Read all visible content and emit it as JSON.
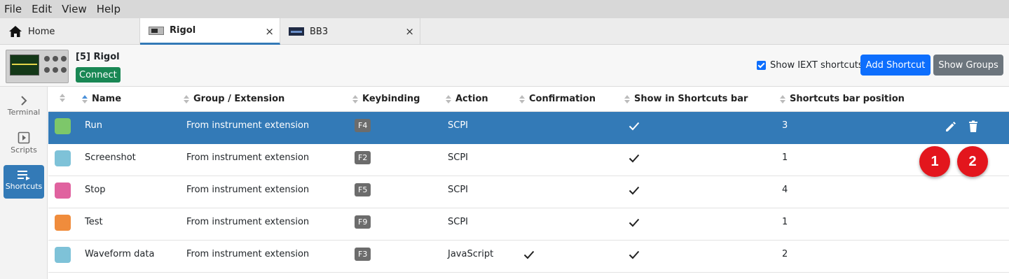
{
  "menu": [
    "File",
    "Edit",
    "View",
    "Help"
  ],
  "tabs": [
    {
      "label": "Home"
    },
    {
      "label": "Rigol",
      "close": "×"
    },
    {
      "label": "BB3",
      "close": "×"
    }
  ],
  "instrument": {
    "title": "[5] Rigol",
    "connect_label": "Connect"
  },
  "toolbar": {
    "show_iext_label": "Show IEXT shortcuts",
    "add_shortcut_label": "Add Shortcut",
    "show_groups_label": "Show Groups"
  },
  "sidebar": {
    "items": [
      {
        "label": "Terminal",
        "icon": "chevron-right-icon"
      },
      {
        "label": "Scripts",
        "icon": "play-box-icon"
      },
      {
        "label": "Shortcuts",
        "icon": "shortcuts-list-icon"
      }
    ]
  },
  "table": {
    "columns": [
      "Name",
      "Group / Extension",
      "Keybinding",
      "Action",
      "Confirmation",
      "Show in Shortcuts bar",
      "Shortcuts bar position"
    ],
    "rows": [
      {
        "color": "#7dc76a",
        "name": "Run",
        "group": "From instrument extension",
        "key": "F4",
        "action": "SCPI",
        "confirmation": false,
        "show_in_bar": true,
        "position": "3"
      },
      {
        "color": "#7ec2d8",
        "name": "Screenshot",
        "group": "From instrument extension",
        "key": "F2",
        "action": "SCPI",
        "confirmation": false,
        "show_in_bar": true,
        "position": "1"
      },
      {
        "color": "#e0629f",
        "name": "Stop",
        "group": "From instrument extension",
        "key": "F5",
        "action": "SCPI",
        "confirmation": false,
        "show_in_bar": true,
        "position": "4"
      },
      {
        "color": "#f08c3c",
        "name": "Test",
        "group": "From instrument extension",
        "key": "F9",
        "action": "SCPI",
        "confirmation": false,
        "show_in_bar": true,
        "position": "1"
      },
      {
        "color": "#7ec2d8",
        "name": "Waveform data",
        "group": "From instrument extension",
        "key": "F3",
        "action": "JavaScript",
        "confirmation": true,
        "show_in_bar": true,
        "position": "2"
      }
    ]
  },
  "callouts": [
    "1",
    "2"
  ],
  "colors": {
    "accent": "#337ab7",
    "primary": "#0d6efd",
    "secondary": "#6c757d",
    "success": "#198754",
    "callout": "#e3161d"
  }
}
